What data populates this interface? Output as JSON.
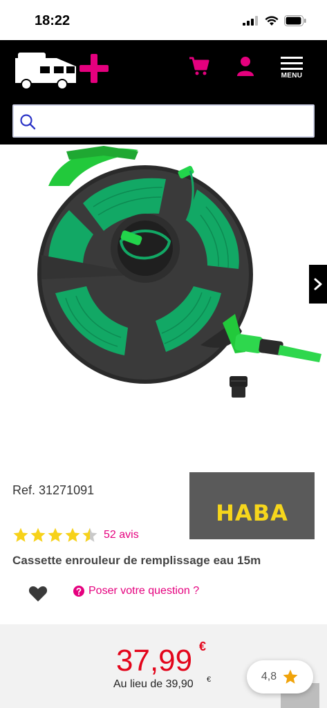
{
  "status_bar": {
    "time": "18:22"
  },
  "header": {
    "menu_label": "MENU",
    "search_placeholder": ""
  },
  "product": {
    "ref": "Ref. 31271091",
    "brand": "HABA",
    "rating_stars": 4.5,
    "reviews": "52 avis",
    "title": "Cassette enrouleur de remplissage eau 15m",
    "ask_question": "Poser votre question ?"
  },
  "price": {
    "current": "37,99",
    "currency": "€",
    "old_label": "Au lieu de 39,90",
    "old_currency": "€"
  },
  "rating_badge": {
    "value": "4,8"
  },
  "colors": {
    "accent": "#e5007e",
    "price": "#e3051b",
    "header": "#000000",
    "brand_yellow": "#f6d61c"
  }
}
